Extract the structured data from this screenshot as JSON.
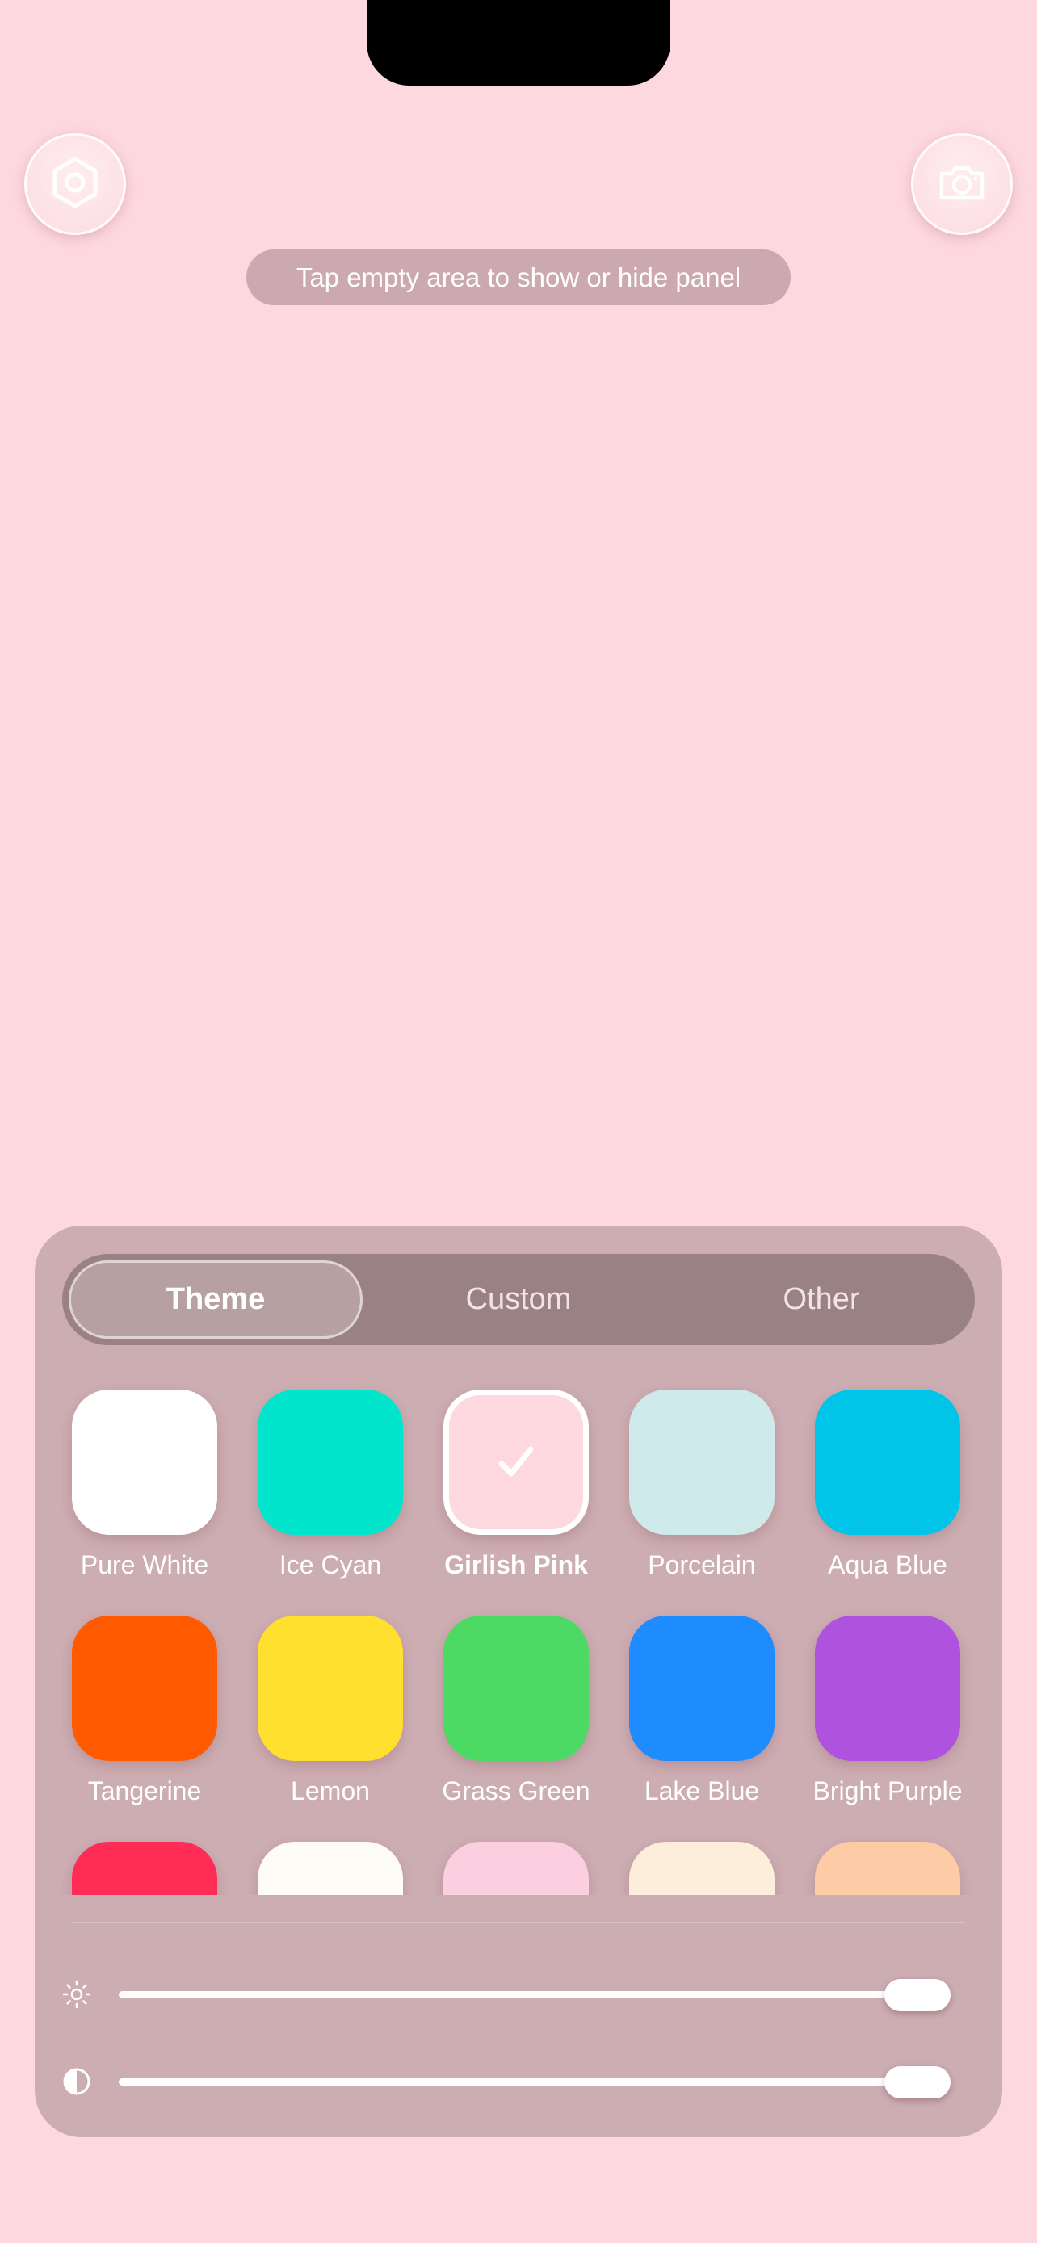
{
  "hint": {
    "text": "Tap empty area to show or hide panel"
  },
  "top_buttons": [
    {
      "icon": "settings-hexagon-icon"
    },
    {
      "icon": "camera-icon"
    }
  ],
  "tabs": [
    {
      "label": "Theme",
      "active": true
    },
    {
      "label": "Custom",
      "active": false
    },
    {
      "label": "Other",
      "active": false
    }
  ],
  "swatches": [
    {
      "label": "Pure White",
      "color": "#FFFFFF",
      "selected": false
    },
    {
      "label": "Ice Cyan",
      "color": "#00E5CC",
      "selected": false
    },
    {
      "label": "Girlish Pink",
      "color": "#FDD8DE",
      "selected": true
    },
    {
      "label": "Porcelain",
      "color": "#CFEAEB",
      "selected": false
    },
    {
      "label": "Aqua Blue",
      "color": "#00C5E8",
      "selected": false
    },
    {
      "label": "Tangerine",
      "color": "#FF5A00",
      "selected": false
    },
    {
      "label": "Lemon",
      "color": "#FFE02E",
      "selected": false
    },
    {
      "label": "Grass Green",
      "color": "#4CDA64",
      "selected": false
    },
    {
      "label": "Lake Blue",
      "color": "#1E8BFF",
      "selected": false
    },
    {
      "label": "Bright Purple",
      "color": "#AF52DE",
      "selected": false
    },
    {
      "label": "",
      "color": "#FF2D55",
      "selected": false
    },
    {
      "label": "",
      "color": "#FEFCF6",
      "selected": false
    },
    {
      "label": "",
      "color": "#FBCFE0",
      "selected": false
    },
    {
      "label": "",
      "color": "#FDEEDB",
      "selected": false
    },
    {
      "label": "",
      "color": "#FDCBA6",
      "selected": false
    }
  ],
  "sliders": {
    "brightness": {
      "icon": "sun-icon",
      "value": 1.0
    },
    "contrast": {
      "icon": "half-circle-icon",
      "value": 1.0
    }
  },
  "colors": {
    "background": "#FDD8DE",
    "panel": "#CCADB2",
    "segment": "#9A8184"
  }
}
